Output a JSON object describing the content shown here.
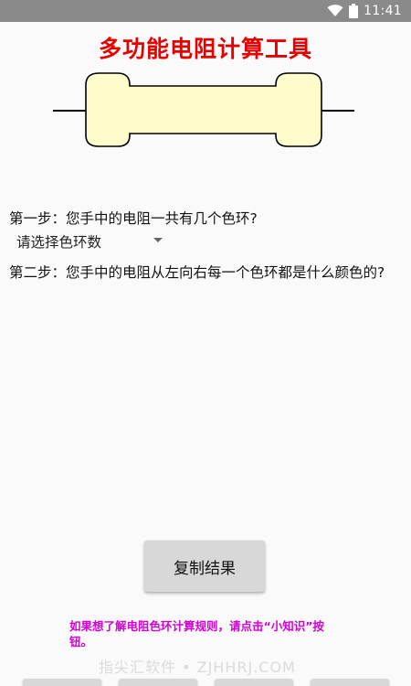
{
  "status_bar": {
    "time": "11:41",
    "icons": [
      "wifi-icon",
      "battery-icon"
    ]
  },
  "app": {
    "title": "多功能电阻计算工具"
  },
  "resistor": {
    "body_color": "#fffccc",
    "outline_color": "#000000"
  },
  "step1": {
    "question": "第一步：您手中的电阻一共有几个色环?",
    "select_placeholder": "请选择色环数"
  },
  "step2": {
    "question": "第二步：您手中的电阻从左向右每一个色环都是什么颜色的?"
  },
  "actions": {
    "copy_label": "复制结果"
  },
  "hint": {
    "text": "如果想了解电阻色环计算规则，请点击“小知识”按钮。",
    "color": "#d400d4"
  },
  "watermark": {
    "text": "指尖汇软件 • ZJHHRJ.COM"
  },
  "colors": {
    "title": "#e60000",
    "button_bg": "#d8d8d8",
    "status_bar": "#8a8a8a"
  }
}
